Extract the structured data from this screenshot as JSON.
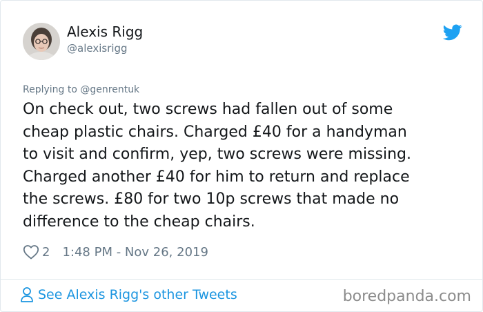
{
  "tweet": {
    "author_name": "Alexis Rigg",
    "author_handle": "@alexisrigg",
    "replying_prefix": "Replying to ",
    "replying_to": "@genrentuk",
    "text_lines": [
      "On check out, two screws had fallen out of some",
      "cheap plastic chairs. Charged £40 for a handyman",
      "to visit and confirm, yep, two screws were missing.",
      "Charged another £40 for him to return and replace",
      "the screws. £80 for two 10p screws that made no",
      "difference to the cheap chairs."
    ],
    "like_count": "2",
    "timestamp": "1:48 PM - Nov 26, 2019"
  },
  "footer": {
    "see_more_label": "See Alexis Rigg's other Tweets",
    "watermark": "boredpanda.com"
  },
  "icons": {
    "brand": "twitter-bird-icon",
    "like": "heart-icon",
    "profile": "person-icon"
  },
  "colors": {
    "twitter_blue": "#1da1f2",
    "link_blue": "#1b95e0",
    "secondary_text": "#657786",
    "primary_text": "#14171a",
    "border": "#e1e8ed"
  }
}
